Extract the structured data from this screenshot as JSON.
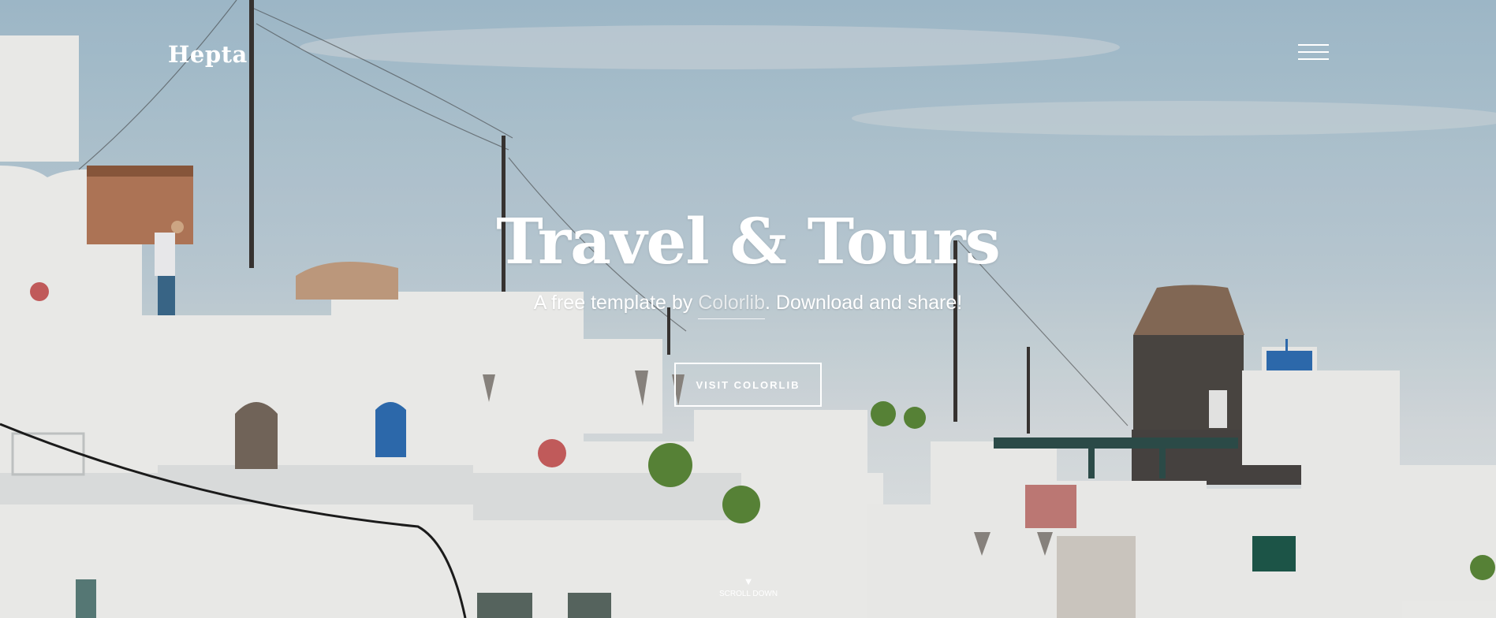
{
  "brand": {
    "logo_text": "Hepta"
  },
  "header": {
    "menu_icon": "hamburger-menu-icon"
  },
  "hero": {
    "title": "Travel & Tours",
    "subtitle_before": "A free template by ",
    "subtitle_link": "Colorlib",
    "subtitle_after": ". Download and share!",
    "cta_label": "VISIT COLORLIB",
    "scroll_arrow": "▼",
    "scroll_label": "SCROLL DOWN"
  },
  "colors": {
    "text": "#ffffff",
    "sky": "#a9c4d3",
    "buildings": "#f2f2f0",
    "dome_blue": "#2f6fb5"
  }
}
